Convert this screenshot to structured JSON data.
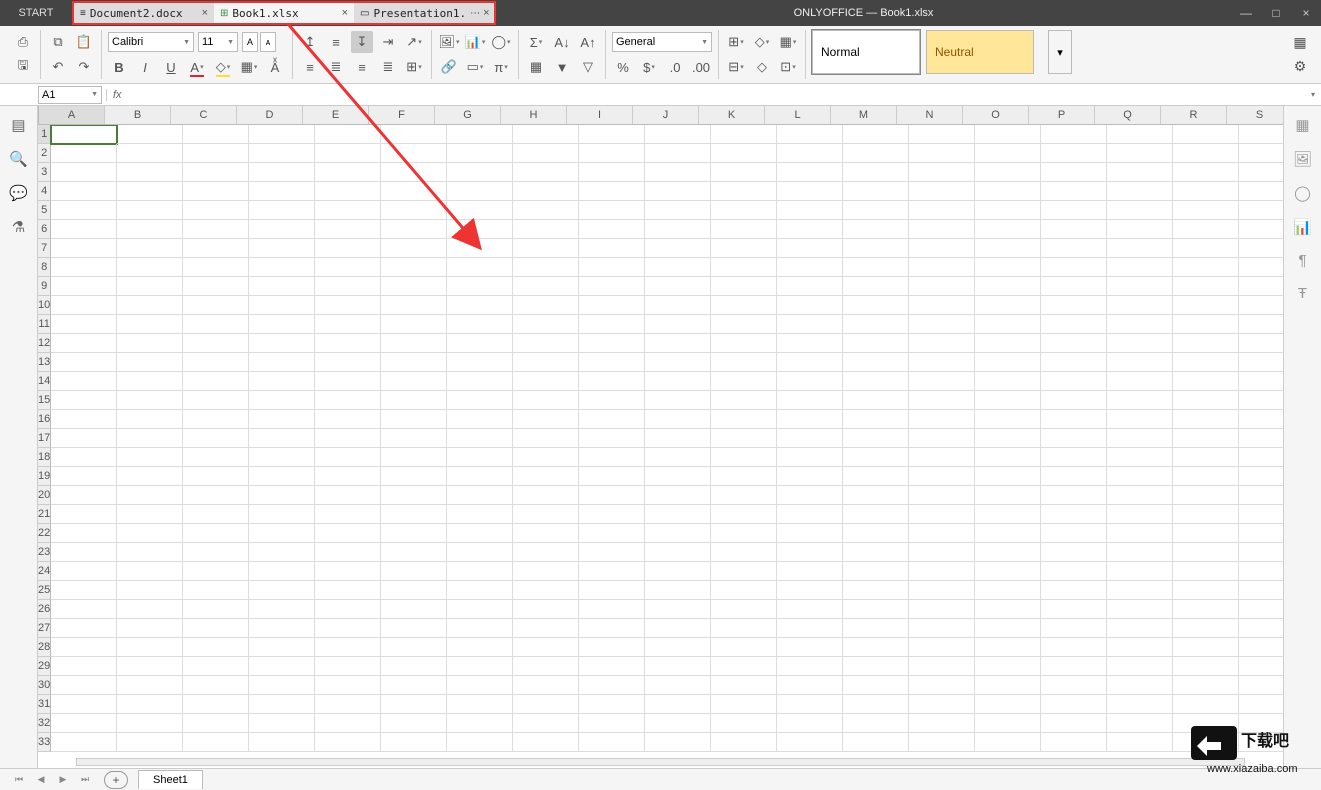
{
  "app": {
    "title": "ONLYOFFICE — Book1.xlsx",
    "start": "START"
  },
  "tabs": [
    {
      "icon": "≡",
      "label": "Document2.docx",
      "active": false
    },
    {
      "icon": "⊞",
      "label": "Book1.xlsx",
      "active": true
    },
    {
      "icon": "▭",
      "label": "Presentation1.",
      "active": false,
      "more": "⋯"
    }
  ],
  "toolbar": {
    "font_name": "Calibri",
    "font_size": "11",
    "number_format": "General",
    "styles": {
      "normal": "Normal",
      "neutral": "Neutral"
    }
  },
  "formula_bar": {
    "name_box": "A1",
    "fx": "fx",
    "value": ""
  },
  "grid": {
    "columns": [
      "A",
      "B",
      "C",
      "D",
      "E",
      "F",
      "G",
      "H",
      "I",
      "J",
      "K",
      "L",
      "M",
      "N",
      "O",
      "P",
      "Q",
      "R",
      "S"
    ],
    "rows": 33,
    "selected_cell": "A1"
  },
  "sheets": {
    "active": "Sheet1"
  },
  "watermark": {
    "line1": "下载吧",
    "line2": "www.xiazaiba.com"
  }
}
